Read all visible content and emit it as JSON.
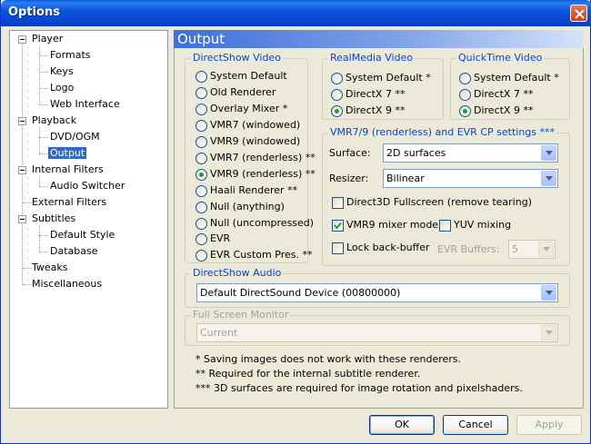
{
  "window": {
    "title": "Options"
  },
  "tree": [
    {
      "label": "Player",
      "level": 0,
      "expanded": true
    },
    {
      "label": "Formats",
      "level": 1
    },
    {
      "label": "Keys",
      "level": 1
    },
    {
      "label": "Logo",
      "level": 1
    },
    {
      "label": "Web Interface",
      "level": 1
    },
    {
      "label": "Playback",
      "level": 0,
      "expanded": true
    },
    {
      "label": "DVD/OGM",
      "level": 1
    },
    {
      "label": "Output",
      "level": 1,
      "selected": true
    },
    {
      "label": "Internal Filters",
      "level": 0,
      "expanded": true
    },
    {
      "label": "Audio Switcher",
      "level": 1
    },
    {
      "label": "External Filters",
      "level": 0
    },
    {
      "label": "Subtitles",
      "level": 0,
      "expanded": true
    },
    {
      "label": "Default Style",
      "level": 1
    },
    {
      "label": "Database",
      "level": 1
    },
    {
      "label": "Tweaks",
      "level": 0
    },
    {
      "label": "Miscellaneous",
      "level": 0
    }
  ],
  "panel": {
    "title": "Output",
    "directshow_video": {
      "title": "DirectShow Video",
      "options": [
        {
          "label": "System Default",
          "checked": false
        },
        {
          "label": "Old Renderer",
          "checked": false
        },
        {
          "label": "Overlay Mixer *",
          "checked": false
        },
        {
          "label": "VMR7 (windowed)",
          "checked": false
        },
        {
          "label": "VMR9 (windowed)",
          "checked": false
        },
        {
          "label": "VMR7 (renderless) **",
          "checked": false
        },
        {
          "label": "VMR9 (renderless) **",
          "checked": true
        },
        {
          "label": "Haali Renderer **",
          "checked": false
        },
        {
          "label": "Null (anything)",
          "checked": false
        },
        {
          "label": "Null (uncompressed)",
          "checked": false
        },
        {
          "label": "EVR",
          "checked": false
        },
        {
          "label": "EVR Custom Pres. **",
          "checked": false
        }
      ]
    },
    "realmedia_video": {
      "title": "RealMedia Video",
      "options": [
        {
          "label": "System Default *",
          "checked": false
        },
        {
          "label": "DirectX 7 **",
          "checked": false
        },
        {
          "label": "DirectX 9 **",
          "checked": true
        }
      ]
    },
    "quicktime_video": {
      "title": "QuickTime Video",
      "options": [
        {
          "label": "System Default *",
          "checked": false
        },
        {
          "label": "DirectX 7 **",
          "checked": false
        },
        {
          "label": "DirectX 9 **",
          "checked": true
        }
      ]
    },
    "vmr_settings": {
      "title": "VMR7/9 (renderless) and EVR CP settings ***",
      "surface_label": "Surface:",
      "surface_value": "2D surfaces",
      "resizer_label": "Resizer:",
      "resizer_value": "Bilinear",
      "d3d_fullscreen": {
        "label": "Direct3D Fullscreen (remove tearing)",
        "checked": false
      },
      "vmr9_mixer": {
        "label": "VMR9 mixer mode",
        "checked": true
      },
      "yuv_mixing": {
        "label": "YUV mixing",
        "checked": false
      },
      "lock_back_buffer": {
        "label": "Lock back-buffer",
        "checked": false
      },
      "evr_buffers_label": "EVR Buffers:",
      "evr_buffers_value": "5"
    },
    "directshow_audio": {
      "title": "DirectShow Audio",
      "value": "Default DirectSound Device (00800000)"
    },
    "fullscreen_monitor": {
      "title": "Full Screen Monitor",
      "value": "Current"
    },
    "notes": [
      "* Saving images does not work with these renderers.",
      "** Required for the internal subtitle renderer.",
      "*** 3D surfaces are required for image rotation and pixelshaders."
    ]
  },
  "buttons": {
    "ok": "OK",
    "cancel": "Cancel",
    "apply": "Apply"
  },
  "colors": {
    "titlebar": "#0645d2",
    "selection": "#316ac5",
    "group_title": "#0046d5"
  }
}
